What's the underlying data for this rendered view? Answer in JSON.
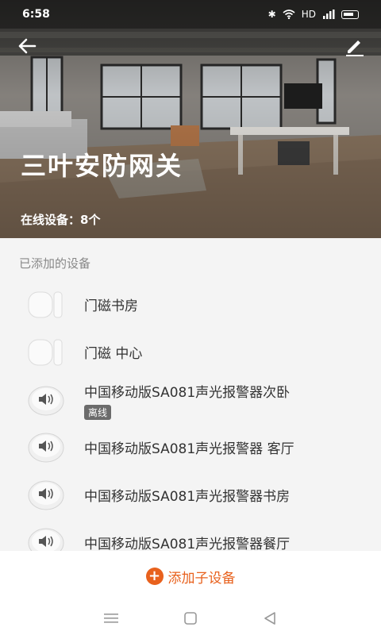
{
  "status_bar": {
    "time": "6:58",
    "network": "HD",
    "signal": "4G"
  },
  "header": {
    "title": "三叶安防网关",
    "online_label": "在线设备：",
    "online_count": "8个"
  },
  "section": {
    "label": "已添加的设备"
  },
  "devices": [
    {
      "name": "门磁书房",
      "type": "door-sensor",
      "offline": ""
    },
    {
      "name": "门磁 中心",
      "type": "door-sensor",
      "offline": ""
    },
    {
      "name": "中国移动版SA081声光报警器次卧",
      "type": "siren",
      "offline": "离线"
    },
    {
      "name": "中国移动版SA081声光报警器 客厅",
      "type": "siren",
      "offline": ""
    },
    {
      "name": "中国移动版SA081声光报警器书房",
      "type": "siren",
      "offline": ""
    },
    {
      "name": "中国移动版SA081声光报警器餐厅",
      "type": "siren",
      "offline": ""
    }
  ],
  "add_button": {
    "label": "添加子设备",
    "icon": "plus-circle-icon"
  },
  "colors": {
    "accent": "#e8611d",
    "badge": "#6b6b6b"
  }
}
